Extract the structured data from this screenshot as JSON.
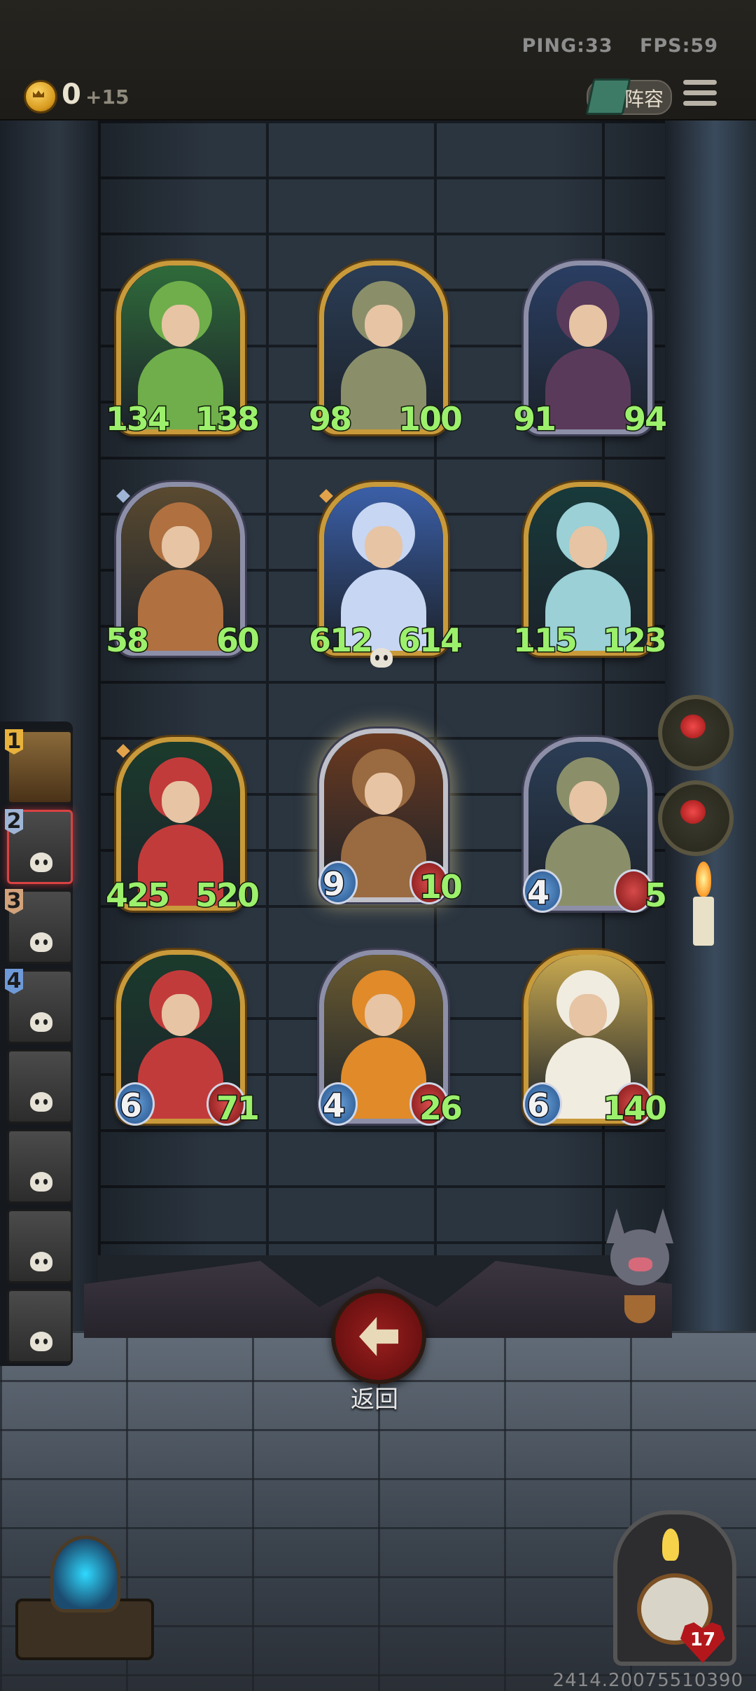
{
  "header": {
    "ping_label": "PING:33",
    "fps_label": "FPS:59",
    "gold": "0",
    "gold_income": "+15",
    "lineup_label": "阵容"
  },
  "board": {
    "cards": [
      {
        "name": "plant-dryad",
        "attack": "134",
        "health": "138",
        "frame": "gold"
      },
      {
        "name": "mushroom-spider",
        "attack": "98",
        "health": "100",
        "frame": "gold"
      },
      {
        "name": "blue-elf",
        "attack": "91",
        "health": "94",
        "frame": "silver"
      },
      {
        "name": "tree-witch",
        "attack": "58",
        "health": "60",
        "frame": "silver"
      },
      {
        "name": "blue-fairy",
        "attack": "612",
        "health": "614",
        "frame": "gold"
      },
      {
        "name": "crowned-princess",
        "attack": "115",
        "health": "123",
        "frame": "gold"
      },
      {
        "name": "rose-elf",
        "attack": "425",
        "health": "520",
        "frame": "gold"
      },
      {
        "name": "archer-boy",
        "attack": "9",
        "health": "10",
        "frame": "highlight"
      },
      {
        "name": "mushroom-spider-small",
        "attack": "4",
        "health": "5",
        "frame": "silver"
      },
      {
        "name": "rose-elf-small",
        "attack": "6",
        "health": "71",
        "frame": "gold"
      },
      {
        "name": "pumpkin-girl",
        "attack": "4",
        "health": "26",
        "frame": "silver"
      },
      {
        "name": "flower-girl",
        "attack": "6",
        "health": "140",
        "frame": "gold"
      }
    ]
  },
  "roster": {
    "slots": [
      {
        "number": "1",
        "rank_color": "#e8b23c"
      },
      {
        "number": "2",
        "rank_color": "#9fb5d6"
      },
      {
        "number": "3",
        "rank_color": "#d2a27a"
      },
      {
        "number": "4",
        "rank_color": "#6f9ad8"
      },
      {
        "number": "",
        "rank_color": ""
      },
      {
        "number": "",
        "rank_color": ""
      },
      {
        "number": "",
        "rank_color": ""
      },
      {
        "number": "",
        "rank_color": ""
      }
    ]
  },
  "actions": {
    "back_label": "返回"
  },
  "status": {
    "hearts": "17",
    "version": "2414.20075510390"
  },
  "colors": {
    "gold_frame": "#c99a3a",
    "silver_frame": "#8d8fa8",
    "stat_green": "#9cf06c",
    "back_button": "#9a1f1f"
  }
}
